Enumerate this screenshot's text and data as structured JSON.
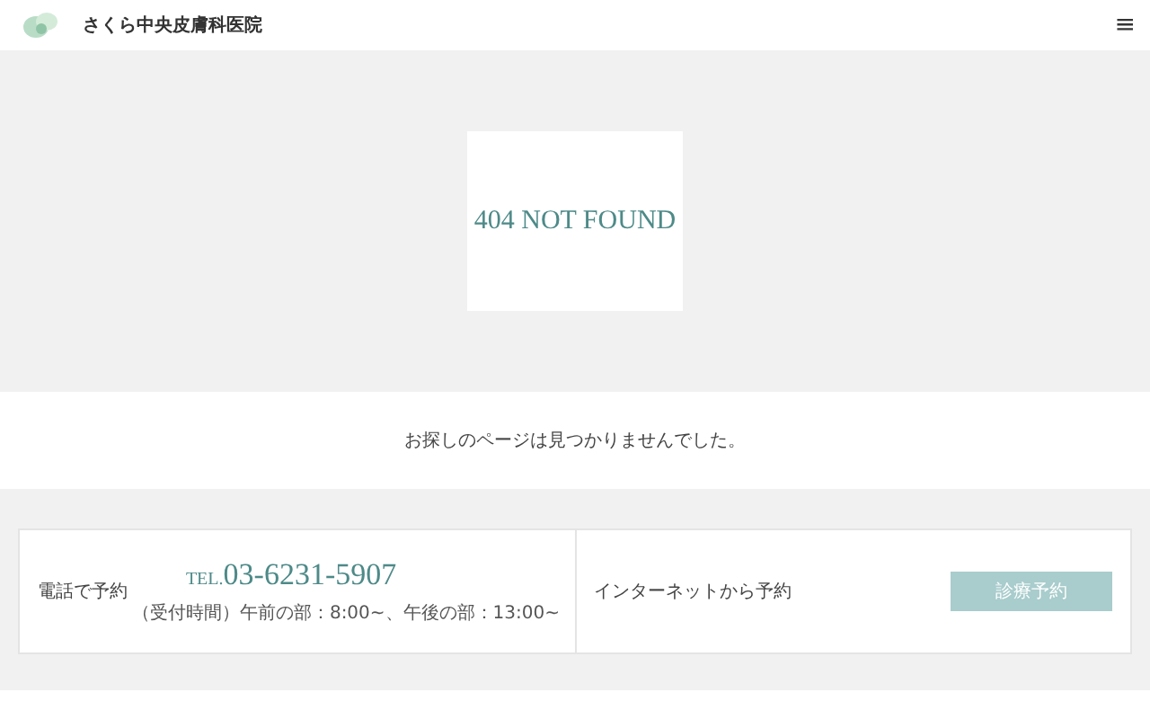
{
  "header": {
    "clinic_name": "さくら中央皮膚科医院",
    "menu_icon": "≡"
  },
  "hero": {
    "title": "404 NOT FOUND"
  },
  "message": "お探しのページは見つかりませんでした。",
  "reservation": {
    "phone": {
      "label": "電話で予約",
      "tel_prefix": "TEL.",
      "number": "03-6231-5907",
      "hours": "（受付時間）午前の部：8:00~、午後の部：13:00~"
    },
    "web": {
      "label": "インターネットから予約",
      "button": "診療予約"
    }
  }
}
